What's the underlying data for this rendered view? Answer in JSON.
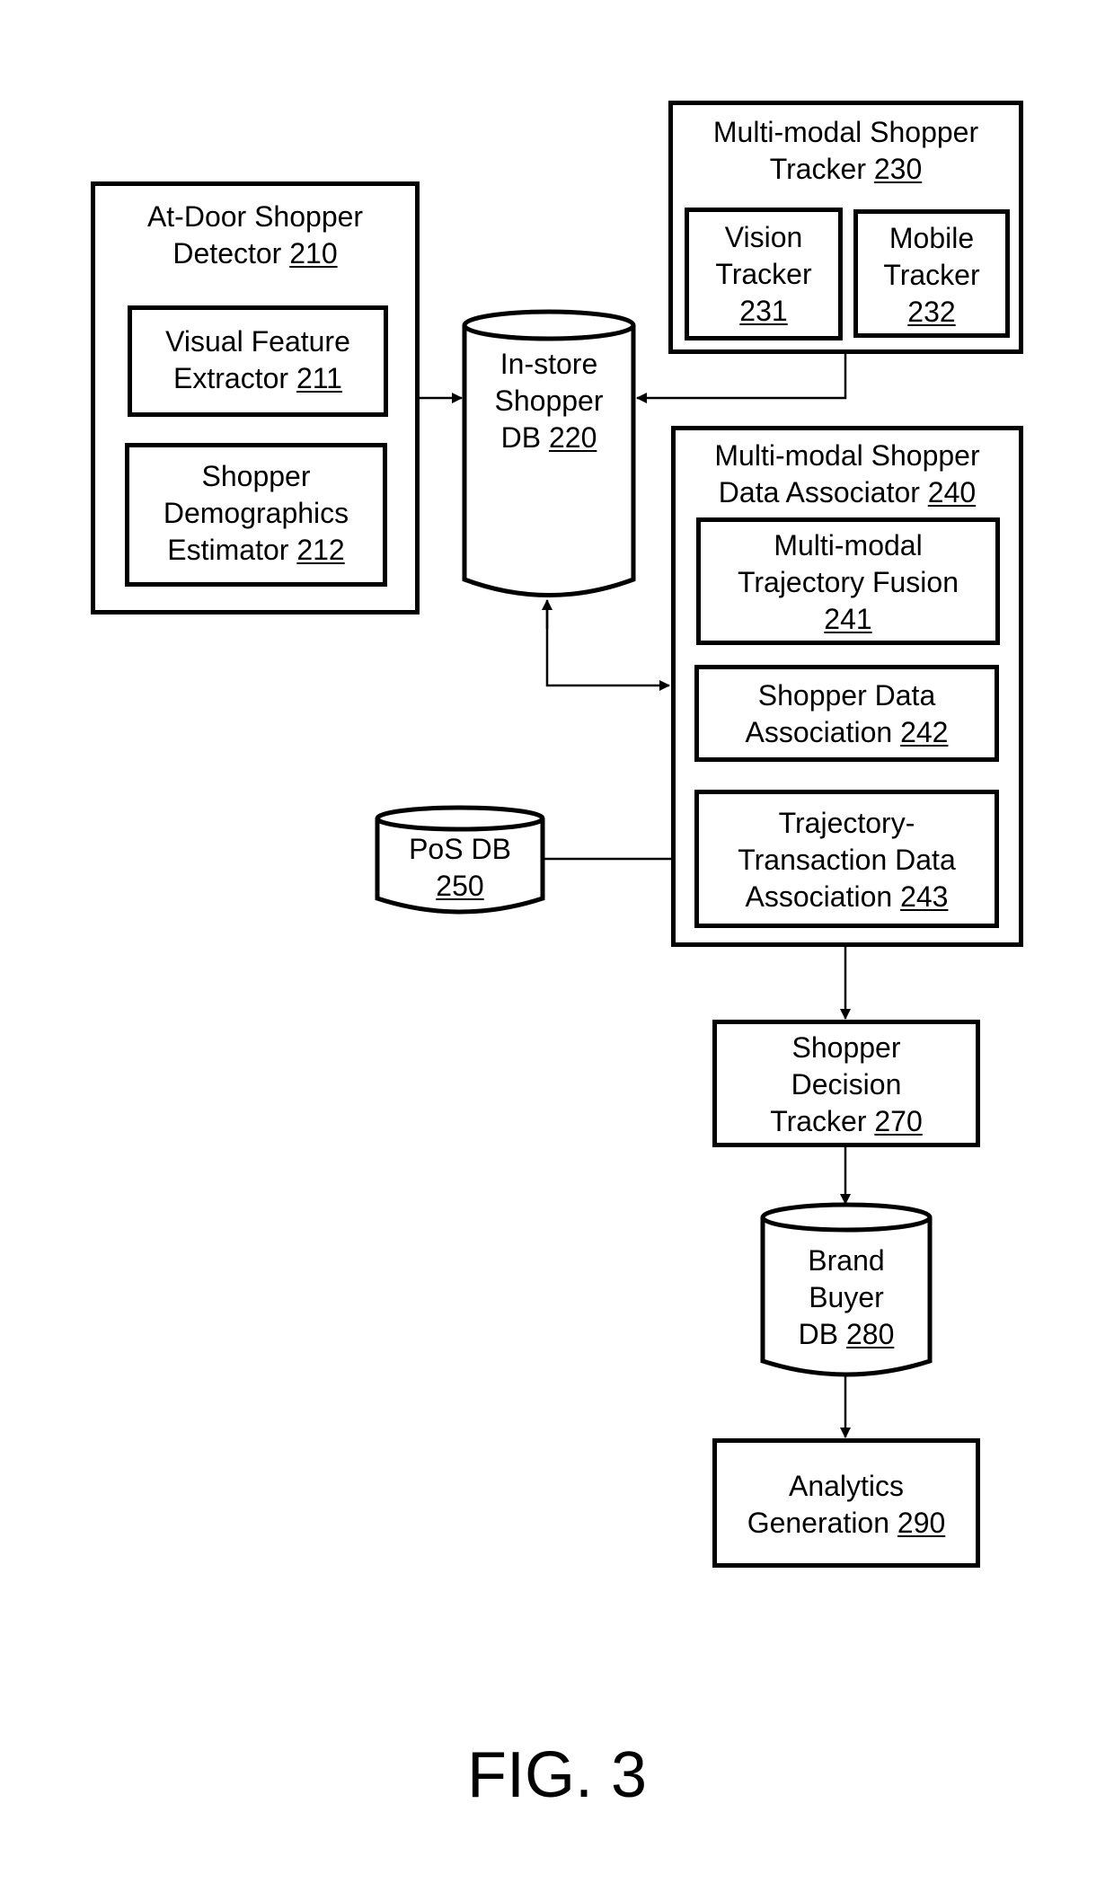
{
  "figure": {
    "caption": "FIG. 3"
  },
  "nodes": {
    "at_door_detector": {
      "lines": [
        "At-Door Shopper",
        "Detector "
      ],
      "ref": "210"
    },
    "visual_feature_extractor": {
      "lines": [
        "Visual Feature",
        "Extractor "
      ],
      "ref": "211"
    },
    "demographics_estimator": {
      "lines": [
        "Shopper",
        "Demographics",
        "Estimator "
      ],
      "ref": "212"
    },
    "instore_shopper_db": {
      "lines": [
        "In-store",
        "Shopper",
        "DB "
      ],
      "ref": "220"
    },
    "multimodal_tracker": {
      "lines": [
        "Multi-modal Shopper",
        "Tracker "
      ],
      "ref": "230"
    },
    "vision_tracker": {
      "lines": [
        "Vision",
        "Tracker",
        ""
      ],
      "ref": "231"
    },
    "mobile_tracker": {
      "lines": [
        "Mobile",
        "Tracker",
        ""
      ],
      "ref": "232"
    },
    "data_associator": {
      "lines": [
        "Multi-modal Shopper",
        "Data Associator "
      ],
      "ref": "240"
    },
    "trajectory_fusion": {
      "lines": [
        "Multi-modal",
        "Trajectory Fusion",
        ""
      ],
      "ref": "241"
    },
    "shopper_data_association": {
      "lines": [
        "Shopper Data",
        "Association "
      ],
      "ref": "242"
    },
    "traj_transaction_association": {
      "lines": [
        "Trajectory-",
        "Transaction Data",
        "Association "
      ],
      "ref": "243"
    },
    "pos_db": {
      "lines": [
        "PoS DB",
        ""
      ],
      "ref": "250"
    },
    "decision_tracker": {
      "lines": [
        "Shopper",
        "Decision",
        "Tracker "
      ],
      "ref": "270"
    },
    "brand_buyer_db": {
      "lines": [
        "Brand",
        "Buyer",
        "DB "
      ],
      "ref": "280"
    },
    "analytics_generation": {
      "lines": [
        "Analytics",
        "Generation "
      ],
      "ref": "290"
    }
  },
  "edges": [
    {
      "from": "at_door_detector",
      "to": "instore_shopper_db",
      "direction": "forward"
    },
    {
      "from": "multimodal_tracker",
      "to": "instore_shopper_db",
      "direction": "forward"
    },
    {
      "from": "instore_shopper_db",
      "to": "data_associator",
      "direction": "bidirectional"
    },
    {
      "from": "pos_db",
      "to": "traj_transaction_association",
      "direction": "forward"
    },
    {
      "from": "data_associator",
      "to": "decision_tracker",
      "direction": "forward"
    },
    {
      "from": "decision_tracker",
      "to": "brand_buyer_db",
      "direction": "forward"
    },
    {
      "from": "brand_buyer_db",
      "to": "analytics_generation",
      "direction": "forward"
    }
  ]
}
